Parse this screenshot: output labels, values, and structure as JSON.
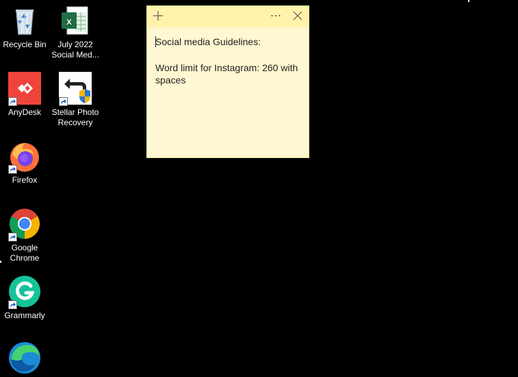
{
  "desktop": {
    "icons": [
      {
        "id": "recycle-bin",
        "label": "Recycle Bin",
        "icon": "recycle-bin-icon"
      },
      {
        "id": "july-2022",
        "label": "July 2022\nSocial Med...",
        "icon": "excel-file-icon"
      },
      {
        "id": "anydesk",
        "label": "AnyDesk",
        "icon": "anydesk-icon"
      },
      {
        "id": "stellar",
        "label": "Stellar Photo\nRecovery",
        "icon": "stellar-photo-recovery-icon"
      },
      {
        "id": "firefox",
        "label": "Firefox",
        "icon": "firefox-icon"
      },
      {
        "id": "chrome",
        "label": "Google\nChrome",
        "icon": "chrome-icon"
      },
      {
        "id": "grammarly",
        "label": "Grammarly",
        "icon": "grammarly-icon"
      },
      {
        "id": "edge",
        "label": "",
        "icon": "edge-icon"
      }
    ]
  },
  "sticky_note": {
    "lines": [
      "Social media Guidelines:",
      "",
      "Word limit for Instagram: 260 with spaces"
    ],
    "colors": {
      "bar": "#fff2ab",
      "body": "#fff7d1"
    }
  }
}
